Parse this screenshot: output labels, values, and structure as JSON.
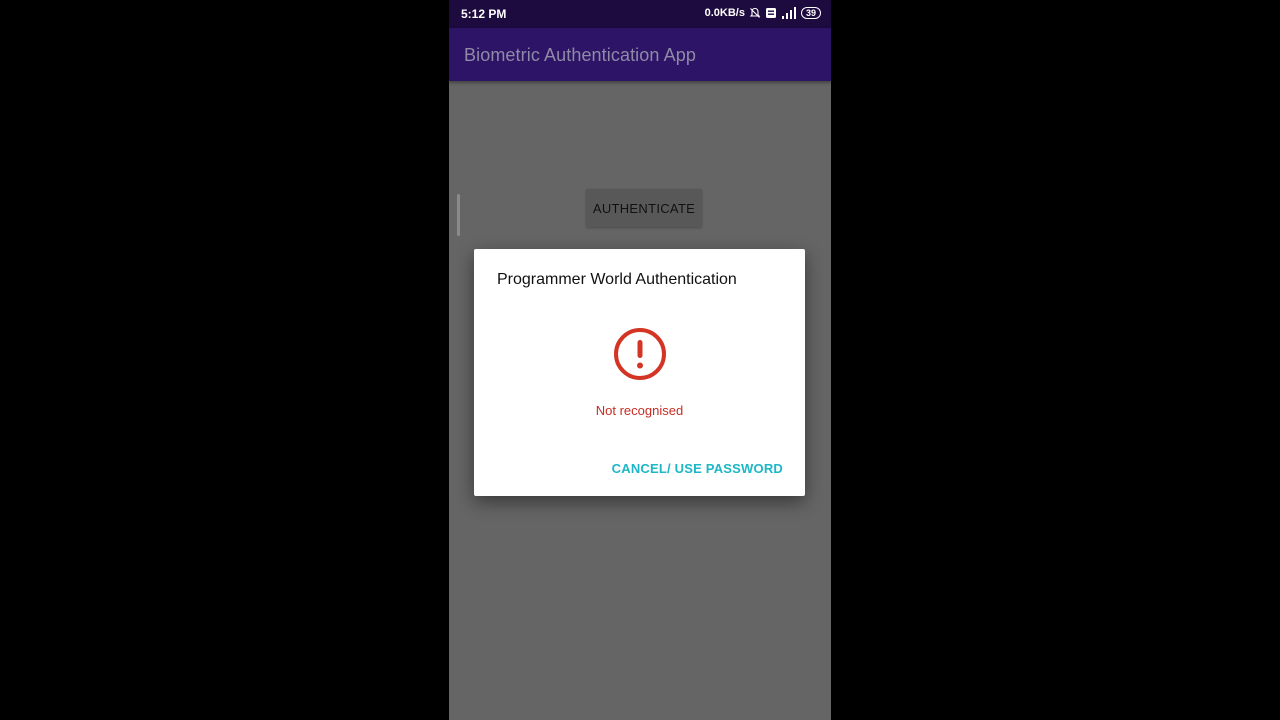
{
  "status_bar": {
    "time": "5:12 PM",
    "network_speed": "0.0KB/s",
    "battery_level": "39",
    "icons": [
      "mute-bell-icon",
      "volte-icon",
      "signal-icon",
      "battery-icon"
    ]
  },
  "app_bar": {
    "title": "Biometric Authentication App"
  },
  "main": {
    "authenticate_label": "AUTHENTICATE"
  },
  "dialog": {
    "title": "Programmer World Authentication",
    "icon": "error-circle-icon",
    "message": "Not recognised",
    "cancel_label": "CANCEL/ USE PASSWORD"
  },
  "colors": {
    "status_bar": "#1d0a3e",
    "app_bar": "#2d1466",
    "scrim_background": "#656565",
    "error": "#c62d23",
    "accent": "#1db7c7"
  }
}
